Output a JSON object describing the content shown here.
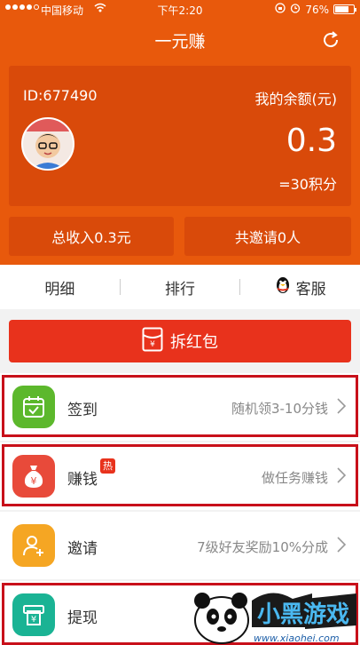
{
  "status_bar": {
    "carrier": "中国移动",
    "time": "下午2:20",
    "battery": "76%",
    "battery_level": 0.76
  },
  "header": {
    "title": "一元赚",
    "refresh_icon": "refresh-icon"
  },
  "account": {
    "id_label": "ID:677490",
    "balance_label": "我的余额(元)",
    "balance": "0.3",
    "points": "=30积分"
  },
  "stats": {
    "total_income": "总收入0.3元",
    "total_invites": "共邀请0人"
  },
  "tabs": [
    {
      "label": "明细"
    },
    {
      "label": "排行"
    },
    {
      "label": "客服",
      "icon": "qq-penguin-icon"
    }
  ],
  "red_packet_button": {
    "label": "拆红包",
    "icon": "red-packet-icon"
  },
  "menu": [
    {
      "label": "签到",
      "desc": "随机领3-10分钱",
      "icon": "calendar-check-icon",
      "color": "#5cb82c",
      "highlighted": true
    },
    {
      "label": "赚钱",
      "desc": "做任务赚钱",
      "badge": "热",
      "icon": "money-bag-icon",
      "color": "#e84a3a",
      "highlighted": true
    },
    {
      "label": "邀请",
      "desc": "7级好友奖励10%分成",
      "icon": "add-user-icon",
      "color": "#f5a623",
      "highlighted": false
    },
    {
      "label": "提现",
      "desc": "",
      "icon": "withdraw-icon",
      "color": "#1ab394",
      "highlighted": true
    }
  ],
  "watermark": {
    "brand": "小黑游戏",
    "url": "www.xiaohei.com"
  },
  "colors": {
    "primary": "#e8590c",
    "card": "#d94a0a",
    "red_button": "#e8321c",
    "highlight_frame": "#c8101a"
  }
}
